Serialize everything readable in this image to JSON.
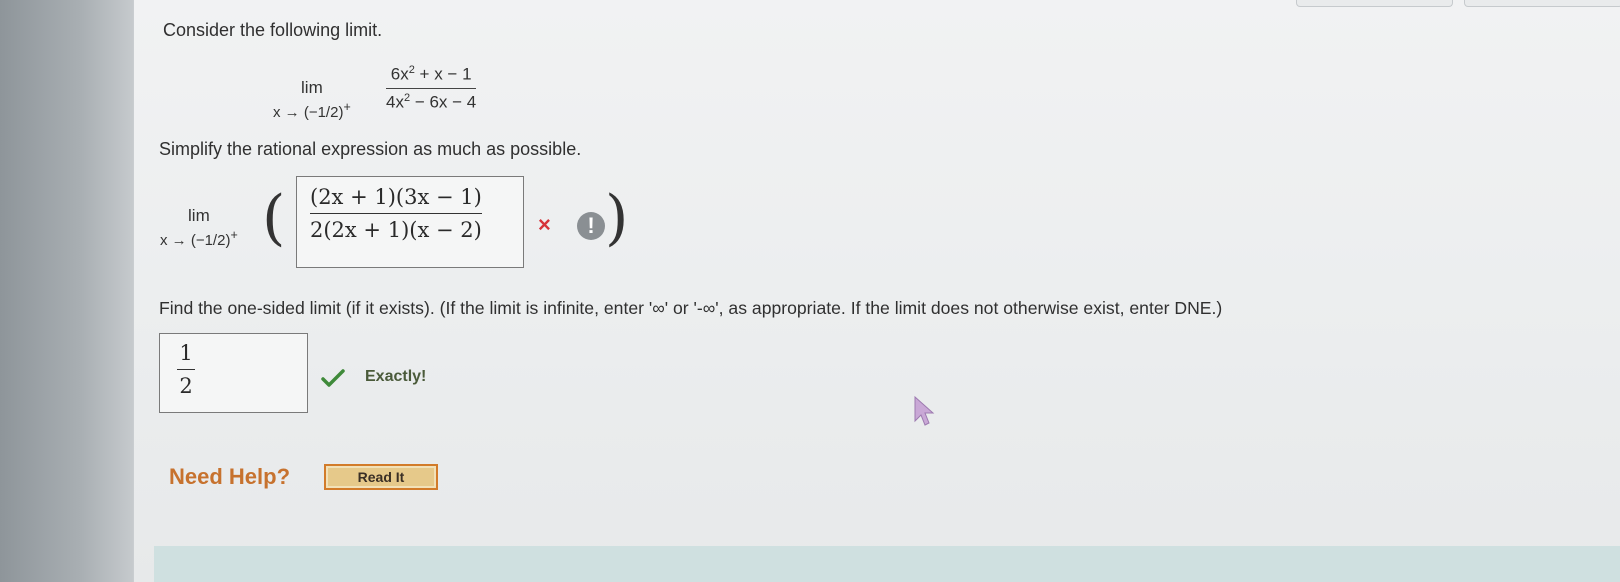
{
  "question": {
    "intro": "Consider the following limit.",
    "limit": {
      "lim": "lim",
      "approach": "x → (−1/2)",
      "approach_sup": "+",
      "numerator_a": "6x",
      "numerator_exp": "2",
      "numerator_b": " + x − 1",
      "denominator_a": "4x",
      "denominator_exp": "2",
      "denominator_b": " − 6x − 4"
    },
    "simplify_prompt": "Simplify the rational expression as much as possible.",
    "simplify_answer": {
      "lim": "lim",
      "approach": "x → (−1/2)",
      "approach_sup": "+",
      "numerator": "(2x + 1)(3x − 1)",
      "denominator": "2(2x + 1)(x − 2)",
      "status_mark": "×",
      "warning_mark": "!"
    },
    "one_sided_prompt": "Find the one-sided limit (if it exists). (If the limit is infinite, enter '∞' or '-∞', as appropriate. If the limit does not otherwise exist, enter DNE.)",
    "one_sided_answer": {
      "numerator": "1",
      "denominator": "2",
      "feedback": "Exactly!"
    }
  },
  "help": {
    "label": "Need Help?",
    "read_it_button": "Read It"
  },
  "colors": {
    "incorrect": "#d6333a",
    "correct": "#3f8a3a",
    "help_text": "#c7722e",
    "button_fill": "#e6c98a",
    "button_border": "#d27b2a"
  }
}
